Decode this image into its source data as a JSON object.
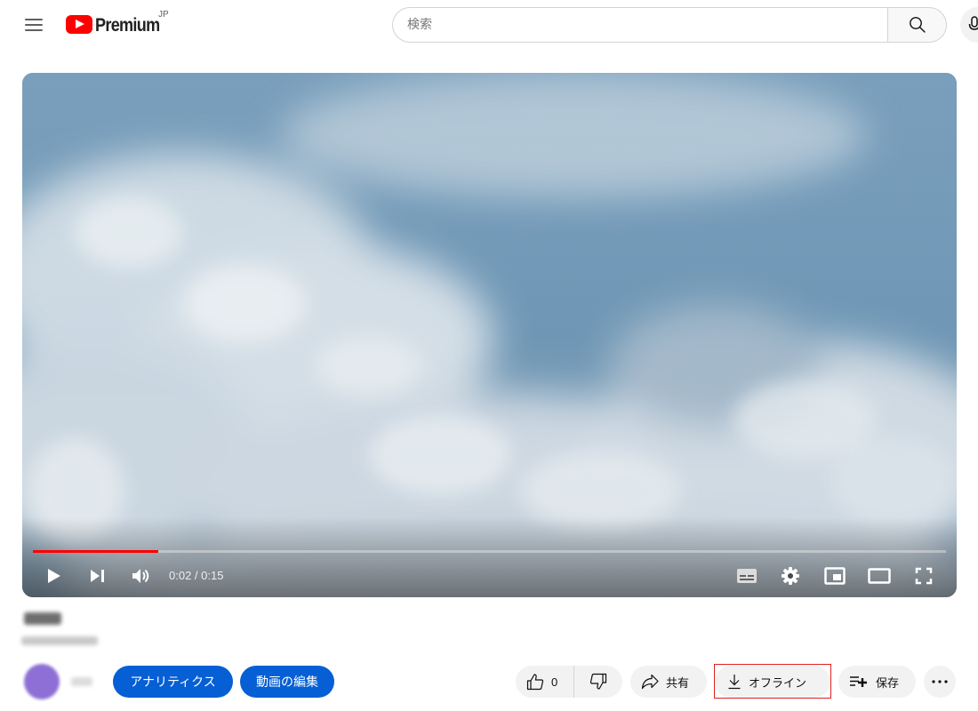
{
  "masthead": {
    "logo_text": "Premium",
    "region": "JP",
    "search_placeholder": "検索"
  },
  "player": {
    "time_display": "0:02 / 0:15",
    "progress_fraction": 0.137
  },
  "actions": {
    "analytics_label": "アナリティクス",
    "edit_label": "動画の編集",
    "like_count": "0",
    "share_label": "共有",
    "offline_label": "オフライン",
    "save_label": "保存"
  },
  "colors": {
    "accent_blue": "#065fd4",
    "brand_red": "#ff0000",
    "highlight_red": "#e02020"
  },
  "icons": [
    "menu-icon",
    "youtube-logo-icon",
    "search-icon",
    "mic-icon",
    "play-icon",
    "next-icon",
    "volume-icon",
    "subtitles-icon",
    "settings-icon",
    "miniplayer-icon",
    "theater-icon",
    "fullscreen-icon",
    "like-icon",
    "dislike-icon",
    "share-icon",
    "download-icon",
    "save-playlist-icon",
    "more-icon"
  ]
}
